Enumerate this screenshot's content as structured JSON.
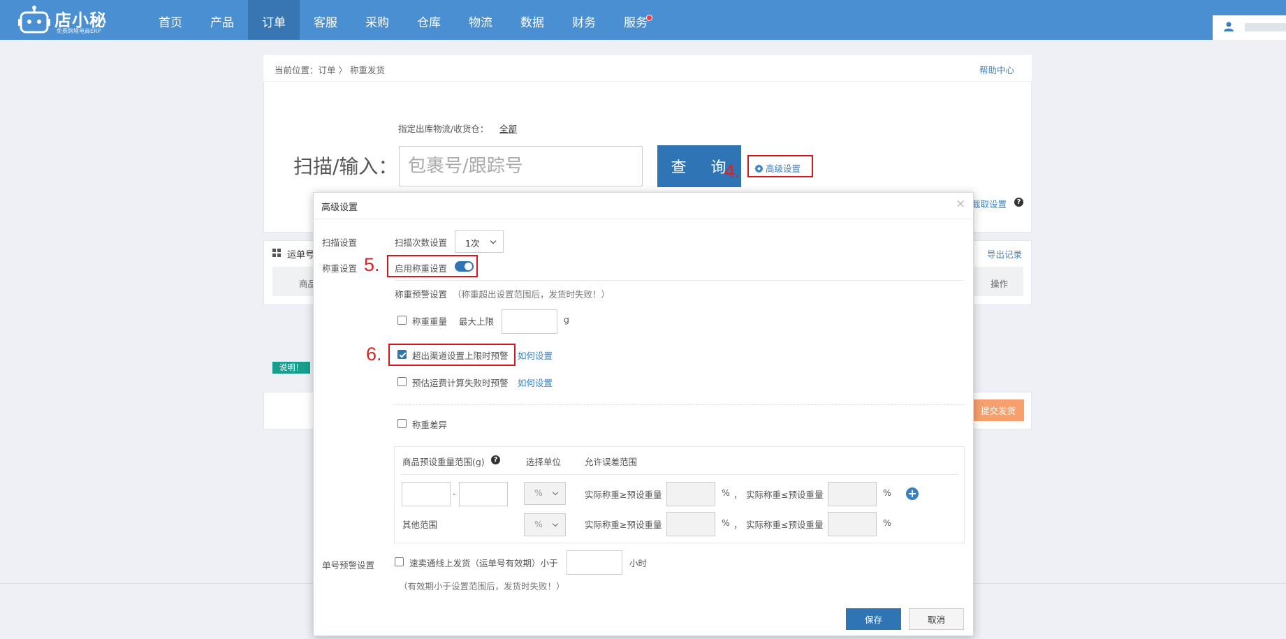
{
  "brand": {
    "name": "店小秘",
    "tagline": "免费跨境电商ERP"
  },
  "nav": {
    "items": [
      {
        "label": "首页"
      },
      {
        "label": "产品"
      },
      {
        "label": "订单"
      },
      {
        "label": "客服"
      },
      {
        "label": "采购"
      },
      {
        "label": "仓库"
      },
      {
        "label": "物流"
      },
      {
        "label": "数据"
      },
      {
        "label": "财务"
      },
      {
        "label": "服务"
      }
    ],
    "active": "订单"
  },
  "breadcrumb": "当前位置：订单 〉 称重发货",
  "help_link": "帮助中心",
  "warehouse": {
    "label": "指定出库物流/收货仓：",
    "value": "全部"
  },
  "scan": {
    "label": "扫描/输入：",
    "placeholder": "包裹号/跟踪号",
    "query_button": "查 询"
  },
  "advanced_button": "高级设置",
  "capture_settings": "截取设置",
  "list": {
    "title": "运单号",
    "col_goods": "商品",
    "col_action": "操作",
    "export": "导出记录",
    "note_badge": "说明！",
    "submit": "提交发货"
  },
  "annotations": {
    "n4": "4.",
    "n5": "5.",
    "n6": "6."
  },
  "modal": {
    "title": "高级设置",
    "close": "×",
    "scan_settings": {
      "label": "扫描设置",
      "count_label": "扫描次数设置",
      "count_value": "1次"
    },
    "weigh_settings": {
      "label": "称重设置",
      "enable_label": "启用称重设置",
      "enabled": true
    },
    "warning_title": "称重预警设置",
    "warning_note": "（称重超出设置范围后，发货时失败！）",
    "weight_check": {
      "label": "称重重量",
      "max_label": "最大上限",
      "unit": "g",
      "checked": false
    },
    "channel_check": {
      "label": "超出渠道设置上限时预警",
      "link": "如何设置",
      "checked": true
    },
    "freight_check": {
      "label": "预估运费计算失败时预警",
      "link": "如何设置",
      "checked": false
    },
    "diff_check": {
      "label": "称重差异",
      "checked": false
    },
    "diff_table": {
      "col_range": "商品预设重量范围(g)",
      "col_unit": "选择单位",
      "col_tolerance": "允许误差范围",
      "dash": "-",
      "unit_value": "%",
      "ge_label": "实际称重≥预设重量",
      "le_label": "实际称重≤预设重量",
      "percent": "%",
      "comma": "，",
      "other_label": "其他范围",
      "add": "+"
    },
    "order_warning": {
      "label": "单号预警设置",
      "check_label": "速卖通线上发货（运单号有效期）小于",
      "unit": "小时",
      "note": "（有效期小于设置范围后，发货时失败！）",
      "checked": false
    },
    "save": "保存",
    "cancel": "取消"
  },
  "colors": {
    "topbar": "#4a8fd1",
    "primary": "#2f74b4",
    "annotation_red": "#d9141b",
    "submit_orange": "#f7a06d",
    "note_teal": "#179e8d"
  }
}
